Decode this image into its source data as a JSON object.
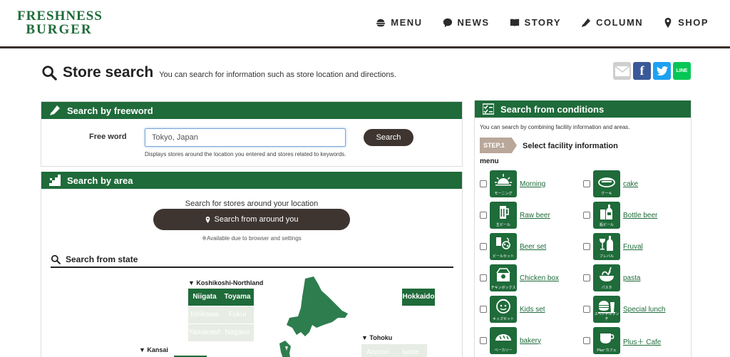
{
  "header": {
    "logo_line1": "FRESHNESS",
    "logo_line2": "BURGER",
    "nav": [
      {
        "label": "MENU",
        "icon": "burger-icon"
      },
      {
        "label": "NEWS",
        "icon": "chat-bubble-icon"
      },
      {
        "label": "STORY",
        "icon": "book-icon"
      },
      {
        "label": "COLUMN",
        "icon": "pencil-icon"
      },
      {
        "label": "SHOP",
        "icon": "map-pin-icon"
      }
    ]
  },
  "page": {
    "title": "Store search",
    "subtitle": "You can search for information such as store location and directions.",
    "share": {
      "facebook": "f",
      "line": "LINE"
    }
  },
  "freeword": {
    "heading": "Search by freeword",
    "label": "Free word",
    "value": "Tokyo, Japan",
    "button": "Search",
    "hint": "Displays stores around the location you entered and stores related to keywords."
  },
  "area": {
    "heading": "Search by area",
    "around_text": "Search for stores around your location",
    "around_button": "Search from around you",
    "note": "※Available due to browser and settings",
    "state_heading": "Search from state",
    "regions": {
      "koshikoshi": "▼ Koshikoshi-Northland",
      "kansai": "▼ Kansai",
      "tohoku": "▼ Tohoku"
    },
    "prefs": {
      "niigata": "Niigata",
      "toyama": "Toyama",
      "ishikawa": "Ishikawa",
      "fukui": "Fukui",
      "yamanashi": "Yamanashi",
      "nagano": "Nagano",
      "hokkaido": "Hokkaido",
      "aomori": "Aomori",
      "iwate": "Iwate"
    }
  },
  "conditions": {
    "heading": "Search from conditions",
    "desc": "You can search by combining facility information and areas.",
    "step": "STEP.1",
    "step_text": "Select facility information",
    "menu_label": "menu",
    "items": [
      {
        "name": "Morning",
        "jp": "モーニング",
        "icon": "sunrise-icon"
      },
      {
        "name": "cake",
        "jp": "ケーキ",
        "icon": "cake-icon"
      },
      {
        "name": "Raw beer",
        "jp": "生ビール",
        "icon": "beer-glass-icon"
      },
      {
        "name": "Bottle beer",
        "jp": "瓶ビール",
        "icon": "beer-bottle-icon"
      },
      {
        "name": "Beer set",
        "jp": "ビールセット",
        "icon": "beer-set-icon"
      },
      {
        "name": "Fruval",
        "jp": "フレバル",
        "icon": "wine-icon"
      },
      {
        "name": "Chicken box",
        "jp": "チキンボックス",
        "icon": "chicken-box-icon"
      },
      {
        "name": "pasta",
        "jp": "パスタ",
        "icon": "pasta-icon"
      },
      {
        "name": "Kids set",
        "jp": "キッズセット",
        "icon": "kids-face-icon"
      },
      {
        "name": "Special lunch",
        "jp": "スペシャルランチ",
        "icon": "lunch-icon"
      },
      {
        "name": "bakery",
        "jp": "ベーカリー",
        "icon": "bread-icon"
      },
      {
        "name": "Plus＋ Cafe",
        "jp": "Plus⁺カフェ",
        "icon": "coffee-cup-icon"
      }
    ]
  },
  "colors": {
    "brand_green": "#1f6b3a",
    "button_dark": "#3e3531",
    "step_tan": "#b9a79a"
  }
}
